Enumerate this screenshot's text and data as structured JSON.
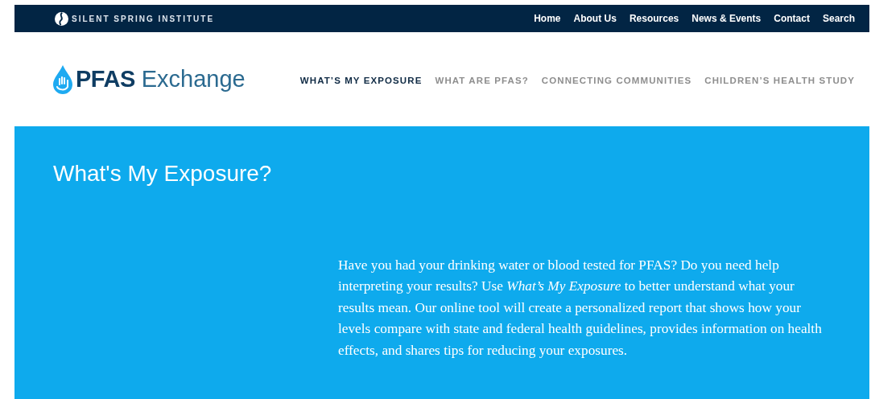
{
  "top_bar": {
    "brand": "SILENT SPRING INSTITUTE",
    "links": [
      {
        "label": "Home"
      },
      {
        "label": "About Us"
      },
      {
        "label": "Resources"
      },
      {
        "label": "News & Events"
      },
      {
        "label": "Contact"
      },
      {
        "label": "Search"
      }
    ]
  },
  "header": {
    "logo_bold": "PFAS",
    "logo_light": "Exchange",
    "nav": [
      {
        "label": "WHAT’S MY EXPOSURE",
        "selected": true
      },
      {
        "label": "WHAT ARE PFAS?",
        "selected": false
      },
      {
        "label": "CONNECTING COMMUNITIES",
        "selected": false
      },
      {
        "label": "CHILDREN’S HEALTH STUDY",
        "selected": false
      }
    ]
  },
  "hero": {
    "title": "What's My Exposure?",
    "text": "Have you had your drinking water or blood tested for PFAS? Do you need help interpreting your results? Use *What’s My Exposure* to better understand what your results mean. Our online tool will create a personalized report that shows how your levels compare with state and federal health guidelines, provides information on health effects, and shares tips for reducing your exposures."
  }
}
